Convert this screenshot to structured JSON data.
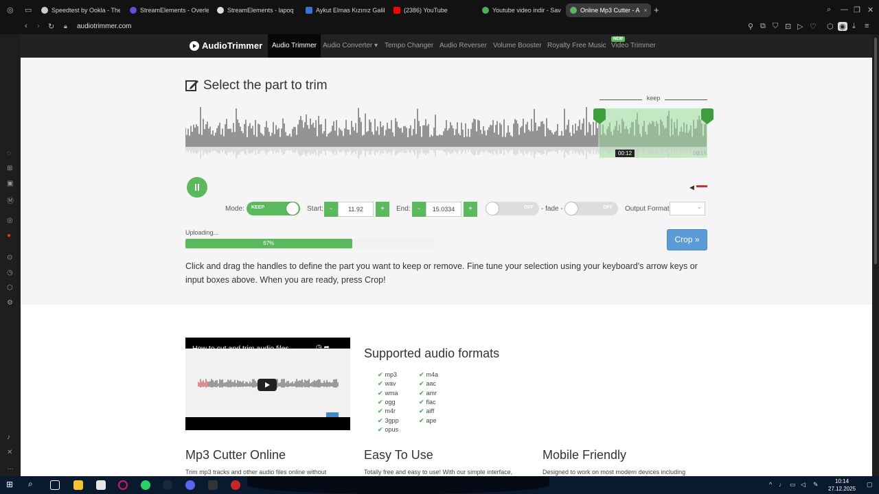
{
  "browser": {
    "tabs": [
      {
        "title": "Speedtest by Ookla - The",
        "color": "#cccccc"
      },
      {
        "title": "StreamElements - Overle",
        "color": "#6a4bd8"
      },
      {
        "title": "StreamElements - lapoq",
        "color": "#dddddd"
      },
      {
        "title": "Aykut Elmas Kızınız Galib",
        "color": "#3b6fd6"
      },
      {
        "title": "(2386) YouTube",
        "color": "#ff0000"
      },
      {
        "title": "Youtube video indir - Sav",
        "color": "#4caf50"
      },
      {
        "title": "Online Mp3 Cutter - A",
        "color": "#5cb85c"
      }
    ],
    "url": "audiotrimmer.com"
  },
  "site": {
    "logo": "AudioTrimmer",
    "nav": [
      "Audio Trimmer",
      "Audio Converter",
      "Tempo Changer",
      "Audio Reverser",
      "Volume Booster",
      "Royalty Free Music",
      "Video Trimmer"
    ],
    "nav_new_badge": "NEW"
  },
  "trimmer": {
    "title": "Select the part to trim",
    "keep_label": "keep",
    "selection_start_fraction": 0.79,
    "selection_end_fraction": 1.0,
    "time_current": "00:12",
    "time_end": "00:15",
    "mode_label": "Mode:",
    "mode_value": "KEEP",
    "start_label": "Start:",
    "start_value": "11.92",
    "end_label": "End:",
    "end_value": "15.0334",
    "minus": "-",
    "plus": "+",
    "fade_in_state": "OFF",
    "fade_label": "- fade -",
    "fade_out_state": "OFF",
    "output_format_label": "Output Format",
    "upload_label": "Uploading...",
    "upload_progress": 67,
    "upload_progress_text": "67%",
    "crop_button": "Crop »",
    "instructions": "Click and drag the handles to define the part you want to keep or remove. Fine tune your selection using your keyboard's arrow keys or input boxes above. When you are ready, press Crop!"
  },
  "video": {
    "title": "How to cut and trim audio files ..."
  },
  "formats": {
    "title": "Supported audio formats",
    "col1": [
      "mp3",
      "wav",
      "wma",
      "ogg",
      "m4r",
      "3gpp",
      "opus"
    ],
    "col2": [
      "m4a",
      "aac",
      "amr",
      "flac",
      "aiff",
      "ape"
    ]
  },
  "features": [
    {
      "title": "Mp3 Cutter Online",
      "desc": "Trim mp3 tracks and other audio files online without"
    },
    {
      "title": "Easy To Use",
      "desc": "Totally free and easy to use! With our simple interface,"
    },
    {
      "title": "Mobile Friendly",
      "desc": "Designed to work on most modern devices including"
    }
  ],
  "taskbar": {
    "time": "10:14",
    "date": "27.12.2025"
  },
  "colors": {
    "accent_green": "#5cb85c",
    "crop_blue": "#5b9bd8",
    "nav_dark": "#222222"
  }
}
